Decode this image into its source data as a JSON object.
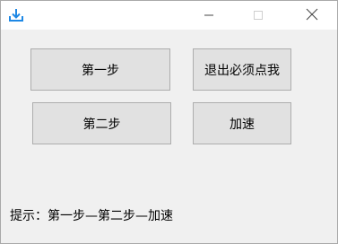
{
  "window": {
    "app_icon": "download-icon",
    "controls": {
      "minimize_icon": "minimize-icon",
      "maximize_icon": "maximize-icon",
      "close_icon": "close-icon"
    }
  },
  "buttons": {
    "step1_label": "第一步",
    "exit_label": "退出必须点我",
    "step2_label": "第二步",
    "speed_label": "加速"
  },
  "hint": {
    "text": "提示：第一步—第二步—加速"
  },
  "colors": {
    "accent": "#1e88e5",
    "button_bg": "#e1e1e1",
    "button_border": "#adadad"
  }
}
